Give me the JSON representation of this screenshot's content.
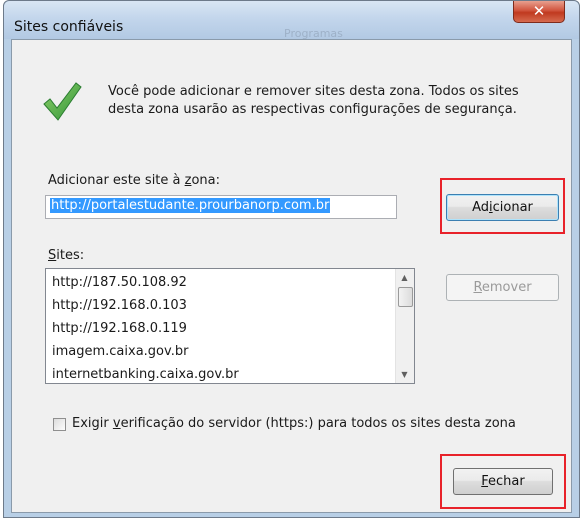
{
  "window": {
    "title": "Sites confiáveis",
    "background_title": "Programas",
    "close_glyph": "✕"
  },
  "info": {
    "icon": "green-checkmark-icon",
    "line1": "Você pode adicionar e remover sites desta zona. Todos os sites",
    "line2": "desta zona usarão as respectivas configurações de segurança."
  },
  "add_site": {
    "label": "Adicionar este site à zona:",
    "label_accel": "z",
    "value": "http://portalestudante.prourbanorp.com.br",
    "button": "Adicionar"
  },
  "sites": {
    "label": "Sites:",
    "items": [
      "http://187.50.108.92",
      "http://192.168.0.103",
      "http://192.168.0.119",
      "imagem.caixa.gov.br",
      "internetbanking.caixa.gov.br"
    ],
    "remove_button": "Remover"
  },
  "https_check": {
    "checked": false,
    "label": "Exigir verificação do servidor (https:) para todos os sites desta zona"
  },
  "close_button": "Fechar",
  "colors": {
    "highlight": "#e8222a",
    "selection": "#3399ff",
    "check_green": "#3aa540"
  }
}
